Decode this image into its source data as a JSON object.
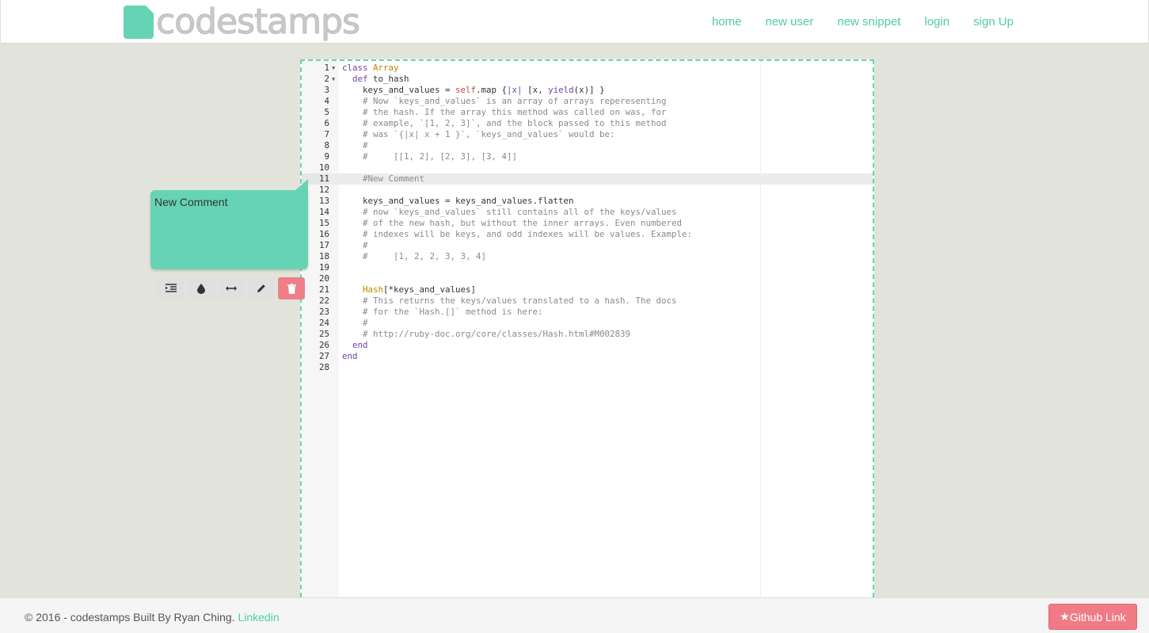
{
  "header": {
    "logo_text": "codestamps",
    "nav": [
      "home",
      "new user",
      "new snippet",
      "login",
      "sign Up"
    ]
  },
  "editor": {
    "active_line": 11,
    "lines": [
      {
        "n": "1",
        "fold": true,
        "tokens": [
          [
            "kw",
            "class "
          ],
          [
            "cls",
            "Array"
          ]
        ]
      },
      {
        "n": "2",
        "fold": true,
        "tokens": [
          [
            "kw",
            "  def "
          ],
          [
            "txt",
            "to_hash"
          ]
        ]
      },
      {
        "n": "3",
        "fold": false,
        "tokens": [
          [
            "txt",
            "    keys_and_values = "
          ],
          [
            "self",
            "self"
          ],
          [
            "txt",
            ".map {"
          ],
          [
            "kw",
            "|x|"
          ],
          [
            "txt",
            " [x, "
          ],
          [
            "kw",
            "yield"
          ],
          [
            "txt",
            "(x)] }"
          ]
        ]
      },
      {
        "n": "4",
        "fold": false,
        "tokens": [
          [
            "cmt",
            "    # Now `keys_and_values` is an array of arrays reperesenting"
          ]
        ]
      },
      {
        "n": "5",
        "fold": false,
        "tokens": [
          [
            "cmt",
            "    # the hash. If the array this method was called on was, for"
          ]
        ]
      },
      {
        "n": "6",
        "fold": false,
        "tokens": [
          [
            "cmt",
            "    # example, `[1, 2, 3]`, and the block passed to this method"
          ]
        ]
      },
      {
        "n": "7",
        "fold": false,
        "tokens": [
          [
            "cmt",
            "    # was `{|x| x + 1 }`, `keys_and_values` would be:"
          ]
        ]
      },
      {
        "n": "8",
        "fold": false,
        "tokens": [
          [
            "cmt",
            "    #"
          ]
        ]
      },
      {
        "n": "9",
        "fold": false,
        "tokens": [
          [
            "cmt",
            "    #     [[1, 2], [2, 3], [3, 4]]"
          ]
        ]
      },
      {
        "n": "10",
        "fold": false,
        "tokens": []
      },
      {
        "n": "11",
        "fold": false,
        "tokens": [
          [
            "cmt",
            "    #New Comment"
          ]
        ]
      },
      {
        "n": "12",
        "fold": false,
        "tokens": []
      },
      {
        "n": "13",
        "fold": false,
        "tokens": [
          [
            "txt",
            "    keys_and_values = keys_and_values.flatten"
          ]
        ]
      },
      {
        "n": "14",
        "fold": false,
        "tokens": [
          [
            "cmt",
            "    # now `keys_and_values` still contains all of the keys/values"
          ]
        ]
      },
      {
        "n": "15",
        "fold": false,
        "tokens": [
          [
            "cmt",
            "    # of the new hash, but without the inner arrays. Even numbered"
          ]
        ]
      },
      {
        "n": "16",
        "fold": false,
        "tokens": [
          [
            "cmt",
            "    # indexes will be keys, and odd indexes will be values. Example:"
          ]
        ]
      },
      {
        "n": "17",
        "fold": false,
        "tokens": [
          [
            "cmt",
            "    #"
          ]
        ]
      },
      {
        "n": "18",
        "fold": false,
        "tokens": [
          [
            "cmt",
            "    #     [1, 2, 2, 3, 3, 4]"
          ]
        ]
      },
      {
        "n": "19",
        "fold": false,
        "tokens": []
      },
      {
        "n": "20",
        "fold": false,
        "tokens": []
      },
      {
        "n": "21",
        "fold": false,
        "tokens": [
          [
            "cls",
            "    Hash"
          ],
          [
            "txt",
            "[*keys_and_values]"
          ]
        ]
      },
      {
        "n": "22",
        "fold": false,
        "tokens": [
          [
            "cmt",
            "    # This returns the keys/values translated to a hash. The docs"
          ]
        ]
      },
      {
        "n": "23",
        "fold": false,
        "tokens": [
          [
            "cmt",
            "    # for the `Hash.[]` method is here:"
          ]
        ]
      },
      {
        "n": "24",
        "fold": false,
        "tokens": [
          [
            "cmt",
            "    #"
          ]
        ]
      },
      {
        "n": "25",
        "fold": false,
        "tokens": [
          [
            "cmt",
            "    # http://ruby-doc.org/core/classes/Hash.html#M002839"
          ]
        ]
      },
      {
        "n": "26",
        "fold": false,
        "tokens": [
          [
            "kw",
            "  end"
          ]
        ]
      },
      {
        "n": "27",
        "fold": false,
        "tokens": [
          [
            "kw",
            "end"
          ]
        ]
      },
      {
        "n": "28",
        "fold": false,
        "tokens": []
      }
    ]
  },
  "comment": {
    "text": "New Comment"
  },
  "toolbar": {
    "buttons": [
      "indent-icon",
      "color-drop-icon",
      "resize-horizontal-icon",
      "pencil-icon",
      "trash-icon"
    ]
  },
  "footer": {
    "copyright": "© 2016 - codestamps Built By Ryan Ching. ",
    "link": "Linkedin",
    "github_label": "Github Link"
  },
  "colors": {
    "accent": "#66d4b4",
    "link": "#4ecda4",
    "danger": "#ee7f86"
  }
}
